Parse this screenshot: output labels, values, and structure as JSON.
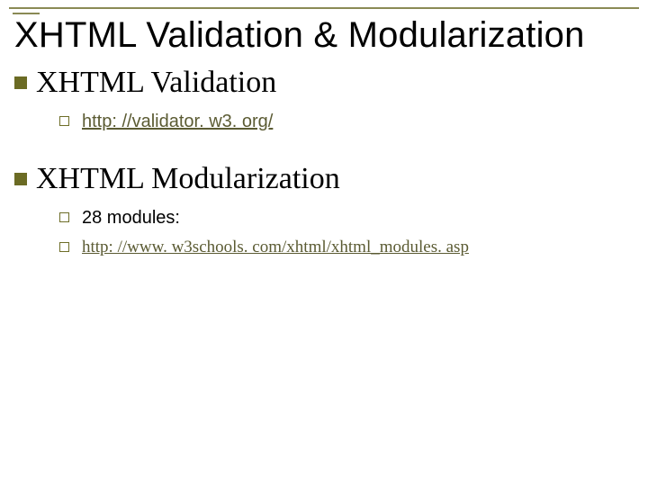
{
  "title": "XHTML Validation & Modularization",
  "sections": [
    {
      "heading": "XHTML Validation",
      "items": [
        {
          "text": "http: //validator. w3. org/",
          "style": "sans",
          "link": true
        }
      ]
    },
    {
      "heading": "XHTML Modularization",
      "items": [
        {
          "text": "28 modules:",
          "style": "sans",
          "link": false
        },
        {
          "text": "http: //www. w3schools. com/xhtml/xhtml_modules. asp",
          "style": "serif",
          "link": true
        }
      ]
    }
  ]
}
